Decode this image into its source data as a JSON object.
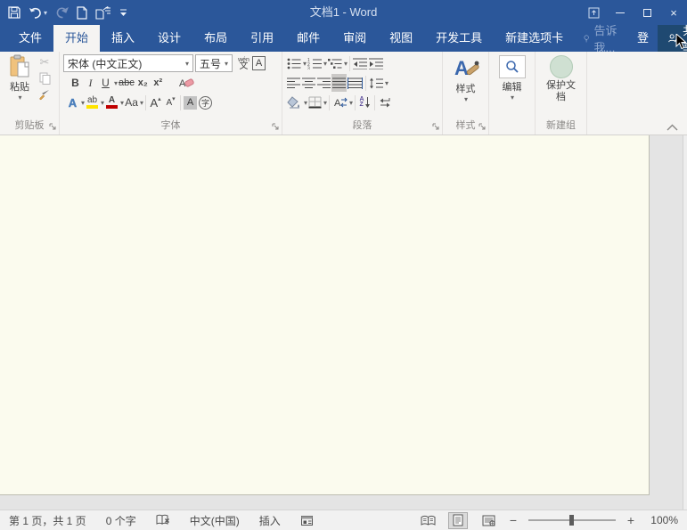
{
  "titlebar": {
    "title": "文档1 - Word"
  },
  "tabs": {
    "items": [
      "文件",
      "开始",
      "插入",
      "设计",
      "布局",
      "引用",
      "邮件",
      "审阅",
      "视图",
      "开发工具",
      "新建选项卡"
    ],
    "tell_me": "告诉我...",
    "sign_in": "登录",
    "share": "共享"
  },
  "ribbon": {
    "clipboard": {
      "paste": "粘贴",
      "label": "剪贴板"
    },
    "font": {
      "name": "宋体 (中文正文)",
      "size": "五号",
      "phonetic_top": "wén",
      "phonetic_char": "文",
      "char_border": "A",
      "bold": "B",
      "italic": "I",
      "underline": "U",
      "strikethrough": "abc",
      "subscript": "x₂",
      "superscript": "x²",
      "text_effects": "A",
      "highlight": "ab",
      "font_color": "A",
      "change_case": "Aa",
      "grow": "A",
      "shrink": "A",
      "char_shading": "A",
      "enclose": "字",
      "label": "字体"
    },
    "paragraph": {
      "sort_a": "A",
      "sort_z": "Z",
      "asian": "A",
      "label": "段落"
    },
    "styles": {
      "button": "样式",
      "label": "样式"
    },
    "editing": {
      "button": "编辑"
    },
    "new_group": {
      "protect": "保护文档",
      "label": "新建组"
    }
  },
  "statusbar": {
    "page_info": "第 1 页，共 1 页",
    "word_count": "0 个字",
    "language": "中文(中国)",
    "insert_mode": "插入",
    "zoom_out": "−",
    "zoom_in": "+",
    "zoom_level": "100%"
  },
  "icons": {
    "dropdown": "▾",
    "up_arrow": "▴",
    "cut": "✂",
    "close": "×"
  },
  "colors": {
    "accent": "#2b579a",
    "share_bg": "#1f4971",
    "tab_active_bg": "#f5f4f2",
    "page": "#fbfbee",
    "highlight_yellow": "#ffe400",
    "font_color_red": "#c00000",
    "protect_green": "#cfe0d2"
  }
}
